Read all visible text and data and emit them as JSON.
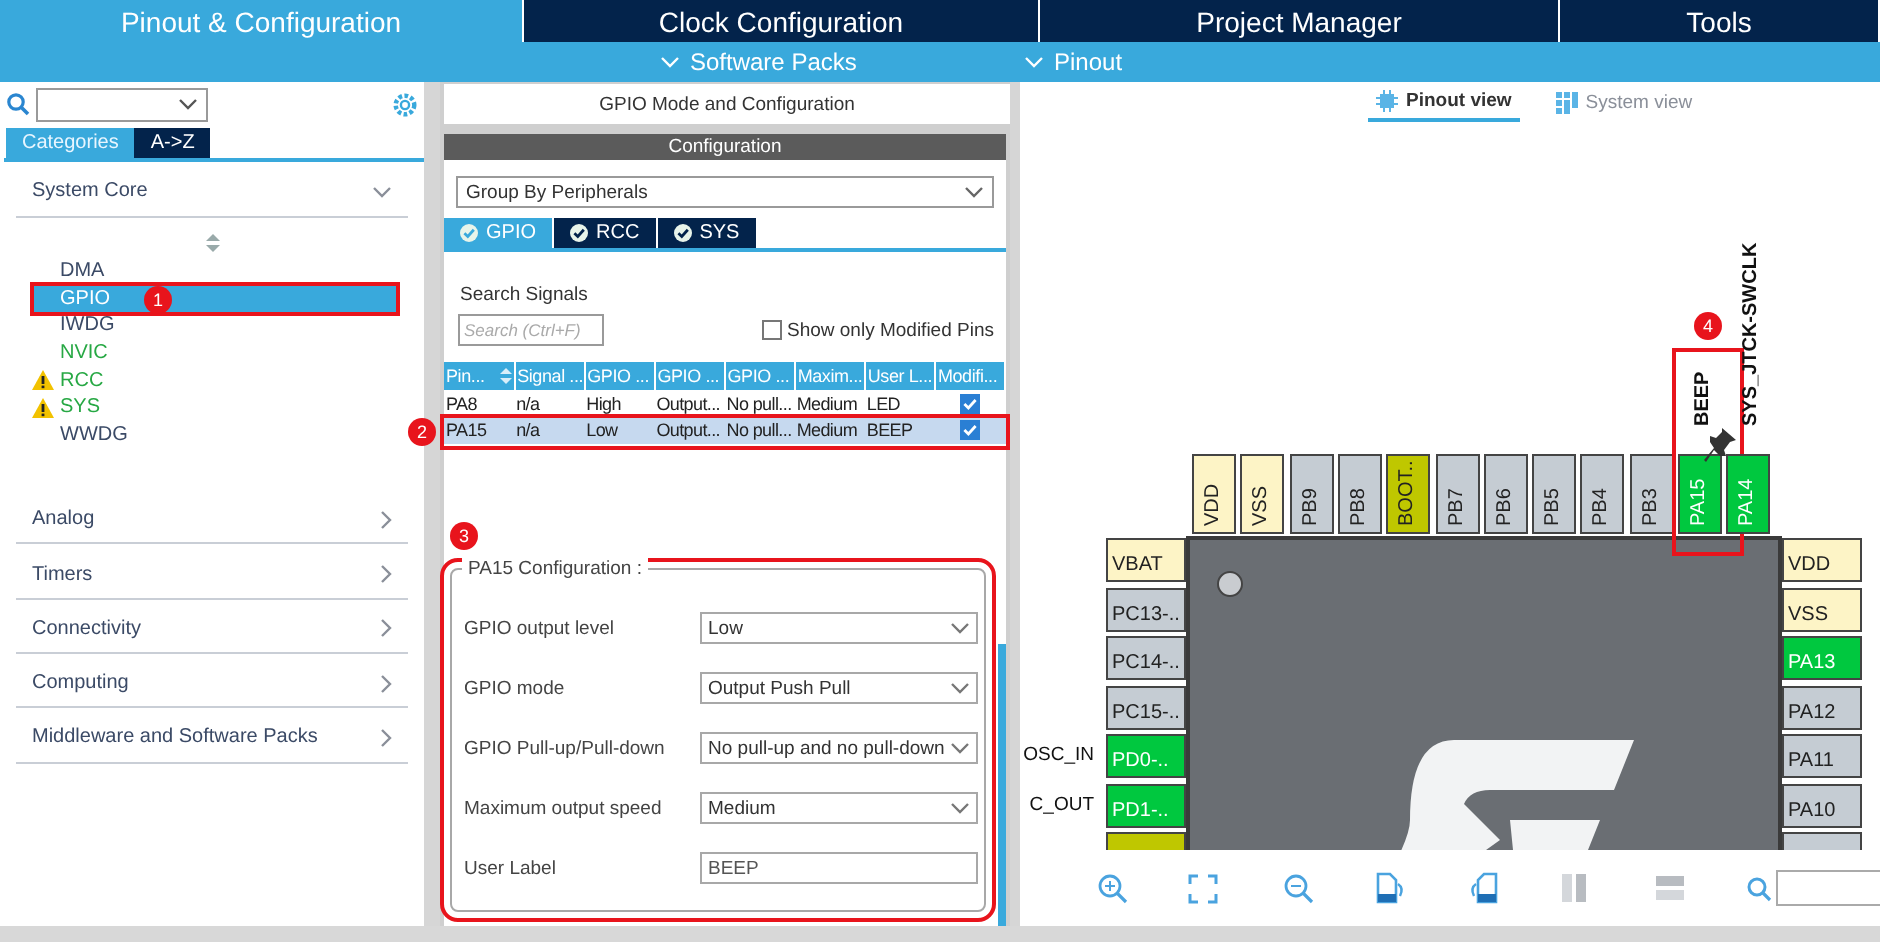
{
  "top_tabs": [
    {
      "label": "Pinout & Configuration",
      "selected": true
    },
    {
      "label": "Clock Configuration",
      "selected": false
    },
    {
      "label": "Project Manager",
      "selected": false
    },
    {
      "label": "Tools",
      "selected": false
    }
  ],
  "sub_bar": [
    {
      "label": "Software Packs"
    },
    {
      "label": "Pinout"
    }
  ],
  "left_panel": {
    "category_tabs": [
      {
        "label": "Categories",
        "selected": true
      },
      {
        "label": "A->Z",
        "selected": false
      }
    ],
    "groups": [
      {
        "label": "System Core",
        "expanded": true,
        "children": [
          {
            "label": "DMA",
            "selected": false,
            "configured": false,
            "warning": false
          },
          {
            "label": "GPIO",
            "selected": true,
            "configured": false,
            "warning": false,
            "marker": "1"
          },
          {
            "label": "IWDG",
            "selected": false,
            "configured": false,
            "warning": false
          },
          {
            "label": "NVIC",
            "selected": false,
            "configured": true,
            "warning": false
          },
          {
            "label": "RCC",
            "selected": false,
            "configured": true,
            "warning": true
          },
          {
            "label": "SYS",
            "selected": false,
            "configured": true,
            "warning": true
          },
          {
            "label": "WWDG",
            "selected": false,
            "configured": false,
            "warning": false
          }
        ]
      },
      {
        "label": "Analog",
        "expanded": false
      },
      {
        "label": "Timers",
        "expanded": false
      },
      {
        "label": "Connectivity",
        "expanded": false
      },
      {
        "label": "Computing",
        "expanded": false
      },
      {
        "label": "Middleware and Software Packs",
        "expanded": false
      }
    ]
  },
  "center": {
    "title": "GPIO Mode and Configuration",
    "config_bar": "Configuration",
    "group_by": "Group By Peripherals",
    "tabs": [
      {
        "label": "GPIO",
        "selected": true
      },
      {
        "label": "RCC",
        "selected": false
      },
      {
        "label": "SYS",
        "selected": false
      }
    ],
    "search_label": "Search Signals",
    "search": {
      "placeholder": "Search (Ctrl+F)"
    },
    "modified_only": {
      "label": "Show only Modified Pins",
      "checked": false
    },
    "table": {
      "columns": [
        "Pin...",
        "Signal ...",
        "GPIO ...",
        "GPIO ...",
        "GPIO ...",
        "Maxim...",
        "User L...",
        "Modifi..."
      ],
      "rows": [
        {
          "cells": [
            "PA8",
            "n/a",
            "High",
            "Output...",
            "No pull...",
            "Medium",
            "LED"
          ],
          "modified": true,
          "selected": false
        },
        {
          "cells": [
            "PA15",
            "n/a",
            "Low",
            "Output...",
            "No pull...",
            "Medium",
            "BEEP"
          ],
          "modified": true,
          "selected": true,
          "marker": "2"
        }
      ]
    },
    "pin_config": {
      "title": "PA15 Configuration :",
      "marker": "3",
      "fields": [
        {
          "label": "GPIO output level",
          "value": "Low",
          "kind": "select"
        },
        {
          "label": "GPIO mode",
          "value": "Output Push Pull",
          "kind": "select"
        },
        {
          "label": "GPIO Pull-up/Pull-down",
          "value": "No pull-up and no pull-down",
          "kind": "select"
        },
        {
          "label": "Maximum output speed",
          "value": "Medium",
          "kind": "select"
        },
        {
          "label": "User Label",
          "value": "BEEP",
          "kind": "text"
        }
      ]
    }
  },
  "right_panel": {
    "view_tabs": [
      {
        "label": "Pinout view",
        "selected": true
      },
      {
        "label": "System view",
        "selected": false
      }
    ],
    "chip": {
      "top_pins": [
        {
          "label": "VDD",
          "kind": "power"
        },
        {
          "label": "VSS",
          "kind": "power"
        },
        {
          "label": "PB9",
          "kind": "gpio"
        },
        {
          "label": "PB8",
          "kind": "gpio"
        },
        {
          "label": "BOOT..",
          "kind": "boot"
        },
        {
          "label": "PB7",
          "kind": "gpio"
        },
        {
          "label": "PB6",
          "kind": "gpio"
        },
        {
          "label": "PB5",
          "kind": "gpio"
        },
        {
          "label": "PB4",
          "kind": "gpio"
        },
        {
          "label": "PB3",
          "kind": "gpio"
        },
        {
          "label": "PA15",
          "kind": "assigned",
          "signal": "BEEP",
          "pinned": true,
          "marker": "4"
        },
        {
          "label": "PA14",
          "kind": "assigned",
          "signal": "SYS_JTCK-SWCLK"
        }
      ],
      "left_pins": [
        {
          "label": "VBAT",
          "kind": "power"
        },
        {
          "label": "PC13-..",
          "kind": "gpio"
        },
        {
          "label": "PC14-..",
          "kind": "gpio"
        },
        {
          "label": "PC15-..",
          "kind": "gpio"
        },
        {
          "label": "PD0-..",
          "kind": "assigned",
          "signal": "OSC_IN"
        },
        {
          "label": "PD1-..",
          "kind": "assigned",
          "signal": "C_OUT"
        },
        {
          "kind": "boot"
        }
      ],
      "right_pins": [
        {
          "label": "VDD",
          "kind": "power"
        },
        {
          "label": "VSS",
          "kind": "power"
        },
        {
          "label": "PA13",
          "kind": "assigned"
        },
        {
          "label": "PA12",
          "kind": "gpio"
        },
        {
          "label": "PA11",
          "kind": "gpio"
        },
        {
          "label": "PA10",
          "kind": "gpio"
        },
        {
          "kind": "gpio"
        }
      ]
    }
  }
}
